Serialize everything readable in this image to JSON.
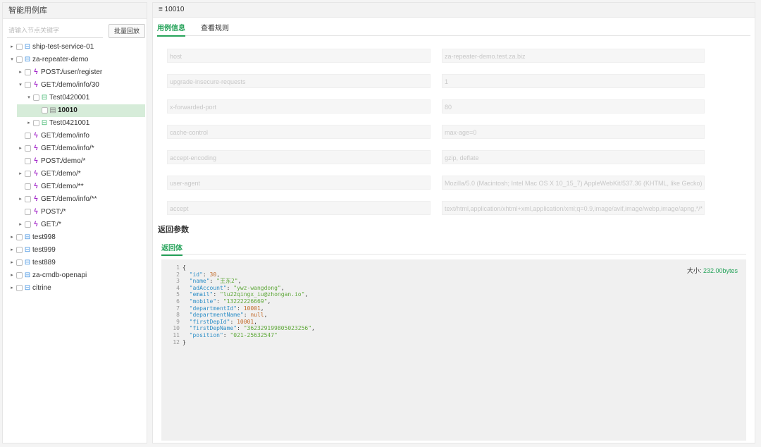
{
  "left": {
    "title": "智能用例库",
    "search_placeholder": "请输入节点关键字",
    "batch_button": "批量回放",
    "tree": [
      {
        "label": "ship-test-service-01",
        "icon": "library",
        "level": 0,
        "arrow": "▸"
      },
      {
        "label": "za-repeater-demo",
        "icon": "library",
        "level": 0,
        "arrow": "▾"
      },
      {
        "label": "POST:/user/register",
        "icon": "bolt",
        "level": 1,
        "arrow": "▸"
      },
      {
        "label": "GET:/demo/info/30",
        "icon": "bolt",
        "level": 1,
        "arrow": "▾"
      },
      {
        "label": "Test0420001",
        "icon": "case",
        "level": 2,
        "arrow": "▾"
      },
      {
        "label": "10010",
        "icon": "doc",
        "level": 3,
        "arrow": "",
        "selected": true
      },
      {
        "label": "Test0421001",
        "icon": "case",
        "level": 2,
        "arrow": "▸"
      },
      {
        "label": "GET:/demo/info",
        "icon": "bolt",
        "level": 1,
        "arrow": ""
      },
      {
        "label": "GET:/demo/info/*",
        "icon": "bolt",
        "level": 1,
        "arrow": "▸"
      },
      {
        "label": "POST:/demo/*",
        "icon": "bolt",
        "level": 1,
        "arrow": ""
      },
      {
        "label": "GET:/demo/*",
        "icon": "bolt",
        "level": 1,
        "arrow": "▸"
      },
      {
        "label": "GET:/demo/**",
        "icon": "bolt",
        "level": 1,
        "arrow": ""
      },
      {
        "label": "GET:/demo/info/**",
        "icon": "bolt",
        "level": 1,
        "arrow": "▸"
      },
      {
        "label": "POST:/*",
        "icon": "bolt",
        "level": 1,
        "arrow": ""
      },
      {
        "label": "GET:/*",
        "icon": "bolt",
        "level": 1,
        "arrow": "▸"
      },
      {
        "label": "test998",
        "icon": "library",
        "level": 0,
        "arrow": "▸"
      },
      {
        "label": "test999",
        "icon": "library",
        "level": 0,
        "arrow": "▸"
      },
      {
        "label": "test889",
        "icon": "library",
        "level": 0,
        "arrow": "▸"
      },
      {
        "label": "za-cmdb-openapi",
        "icon": "library",
        "level": 0,
        "arrow": "▸"
      },
      {
        "label": "citrine",
        "icon": "library",
        "level": 0,
        "arrow": "▸"
      }
    ]
  },
  "right": {
    "title": "10010",
    "title_icon": "≡",
    "tabs": [
      "用例信息",
      "查看规则"
    ],
    "headers": [
      {
        "key": "host",
        "value": "za-repeater-demo.test.za.biz"
      },
      {
        "key": "upgrade-insecure-requests",
        "value": "1"
      },
      {
        "key": "x-forwarded-port",
        "value": "80"
      },
      {
        "key": "cache-control",
        "value": "max-age=0"
      },
      {
        "key": "accept-encoding",
        "value": "gzip, deflate"
      },
      {
        "key": "user-agent",
        "value": "Mozilla/5.0 (Macintosh; Intel Mac OS X 10_15_7) AppleWebKit/537.36 (KHTML, like Gecko) C"
      },
      {
        "key": "accept",
        "value": "text/html,application/xhtml+xml,application/xml;q=0.9,image/avif,image/webp,image/apng,*/*"
      }
    ],
    "section_title": "返回参数",
    "sub_tab": "返回体",
    "size_label": "大小:",
    "size_value": "232.00bytes",
    "body_lines": [
      {
        "n": "1",
        "parts": [
          [
            "p",
            "{"
          ]
        ]
      },
      {
        "n": "2",
        "parts": [
          [
            "k",
            "  \"id\""
          ],
          [
            "p",
            ": "
          ],
          [
            "n",
            "30"
          ],
          [
            "p",
            ","
          ]
        ]
      },
      {
        "n": "3",
        "parts": [
          [
            "k",
            "  \"name\""
          ],
          [
            "p",
            ": "
          ],
          [
            "s",
            "\"王东2\""
          ],
          [
            "p",
            ","
          ]
        ]
      },
      {
        "n": "4",
        "parts": [
          [
            "k",
            "  \"adAccount\""
          ],
          [
            "p",
            ": "
          ],
          [
            "s",
            "\"ywz-wangdong\""
          ],
          [
            "p",
            ","
          ]
        ]
      },
      {
        "n": "5",
        "parts": [
          [
            "k",
            "  \"email\""
          ],
          [
            "p",
            ": "
          ],
          [
            "s",
            "\"lu22qingx_iu@zhongan.io\""
          ],
          [
            "p",
            ","
          ]
        ]
      },
      {
        "n": "6",
        "parts": [
          [
            "k",
            "  \"mobile\""
          ],
          [
            "p",
            ": "
          ],
          [
            "s",
            "\"13222226669\""
          ],
          [
            "p",
            ","
          ]
        ]
      },
      {
        "n": "7",
        "parts": [
          [
            "k",
            "  \"departmentId\""
          ],
          [
            "p",
            ": "
          ],
          [
            "n",
            "10001"
          ],
          [
            "p",
            ","
          ]
        ]
      },
      {
        "n": "8",
        "parts": [
          [
            "k",
            "  \"departmentName\""
          ],
          [
            "p",
            ": "
          ],
          [
            "z",
            "null"
          ],
          [
            "p",
            ","
          ]
        ]
      },
      {
        "n": "9",
        "parts": [
          [
            "k",
            "  \"firstDepId\""
          ],
          [
            "p",
            ": "
          ],
          [
            "n",
            "10001"
          ],
          [
            "p",
            ","
          ]
        ]
      },
      {
        "n": "10",
        "parts": [
          [
            "k",
            "  \"firstDepName\""
          ],
          [
            "p",
            ": "
          ],
          [
            "s",
            "\"362329199805023256\""
          ],
          [
            "p",
            ","
          ]
        ]
      },
      {
        "n": "11",
        "parts": [
          [
            "k",
            "  \"position\""
          ],
          [
            "p",
            ": "
          ],
          [
            "s",
            "\"021-25632547\""
          ]
        ]
      },
      {
        "n": "12",
        "parts": [
          [
            "p",
            "}"
          ]
        ]
      }
    ]
  },
  "colors": {
    "accent": "#26a35a",
    "bolt": "#a020c8",
    "library": "#3d8fe0",
    "selected_bg": "#d6ecd9"
  }
}
